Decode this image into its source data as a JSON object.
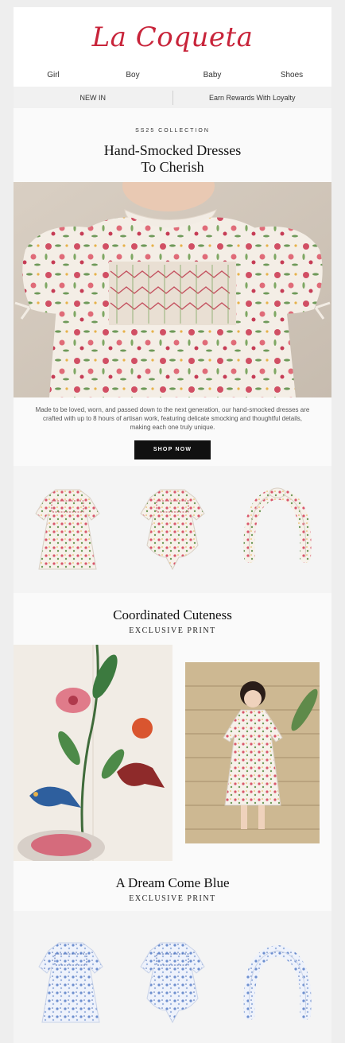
{
  "header": {
    "logo": "La Coqueta"
  },
  "nav": {
    "items": [
      "Girl",
      "Boy",
      "Baby",
      "Shoes"
    ]
  },
  "subnav": {
    "new_in": "NEW IN",
    "rewards": "Earn Rewards With Loyalty"
  },
  "hero": {
    "eyebrow": "SS25 COLLECTION",
    "title_line1": "Hand-Smocked Dresses",
    "title_line2": "To Cherish",
    "body": "Made to be loved, worn, and passed down to the next generation, our hand-smocked dresses are crafted with up to 8 hours of artisan work, featuring delicate smocking and thoughtful details, making each one truly unique.",
    "cta": "SHOP NOW"
  },
  "section1": {
    "title": "Coordinated Cuteness",
    "subtitle": "EXCLUSIVE PRINT"
  },
  "section2": {
    "title": "A Dream Come Blue",
    "subtitle": "EXCLUSIVE PRINT"
  },
  "colors": {
    "brand": "#c8243a",
    "cta_bg": "#111111",
    "blue_print": "#6d8fcf",
    "floral_print": "#d9566b"
  }
}
